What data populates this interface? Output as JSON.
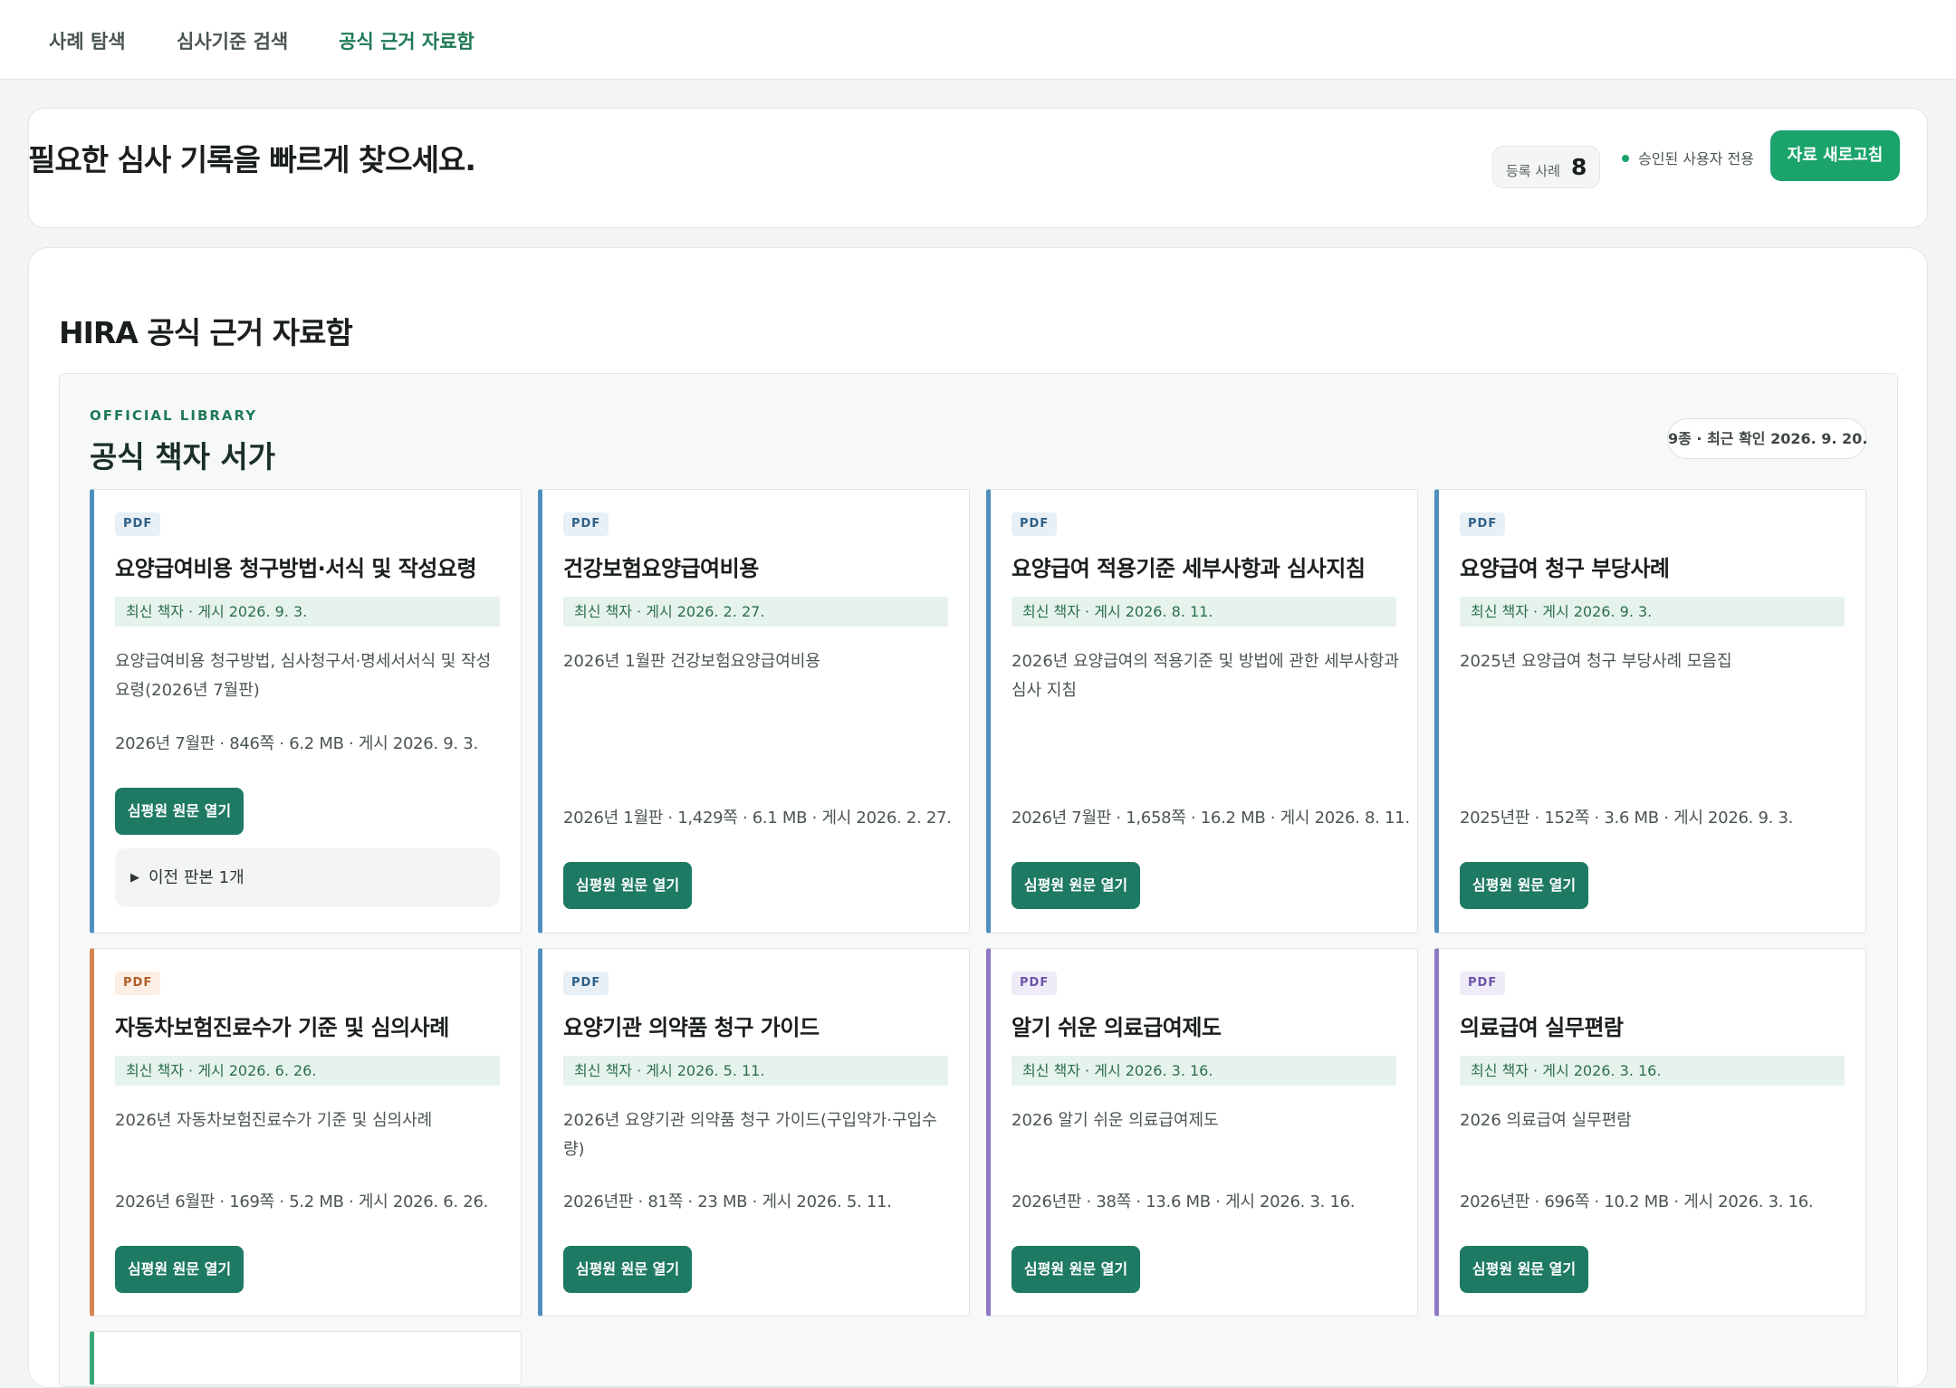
{
  "nav": {
    "tabs": [
      {
        "label": "사례 탐색"
      },
      {
        "label": "심사기준 검색"
      },
      {
        "label": "공식 근거 자료함"
      }
    ]
  },
  "hero": {
    "title": "필요한 심사 기록을 빠르게 찾으세요.",
    "count_label": "등록 사례",
    "count_value": "8",
    "auth_text": "승인된 사용자 전용",
    "refresh_label": "자료 새로고침"
  },
  "panel": {
    "title": "HIRA 공식 근거 자료함"
  },
  "shelf": {
    "eyebrow": "OFFICIAL LIBRARY",
    "title": "공식 책자 서가",
    "meta": "9종 · 최근 확인 2026. 9. 20."
  },
  "cards": [
    {
      "badge": "PDF",
      "title": "요양급여비용 청구방법·서식 및 작성요령",
      "latest": "최신 책자 · 게시 2026. 9. 3.",
      "desc": "요양급여비용 청구방법, 심사청구서·명세서서식 및 작성요령(2026년 7월판)",
      "info": "2026년 7월판 · 846쪽 · 6.2 MB · 게시 2026. 9. 3.",
      "button": "심평원 원문 열기",
      "previous": "이전 판본 1개"
    },
    {
      "badge": "PDF",
      "title": "건강보험요양급여비용",
      "latest": "최신 책자 · 게시 2026. 2. 27.",
      "desc": "2026년 1월판 건강보험요양급여비용",
      "info": "2026년 1월판 · 1,429쪽 · 6.1 MB · 게시 2026. 2. 27.",
      "button": "심평원 원문 열기"
    },
    {
      "badge": "PDF",
      "title": "요양급여 적용기준 세부사항과 심사지침",
      "latest": "최신 책자 · 게시 2026. 8. 11.",
      "desc": "2026년 요양급여의 적용기준 및 방법에 관한 세부사항과 심사 지침",
      "info": "2026년 7월판 · 1,658쪽 · 16.2 MB · 게시 2026. 8. 11.",
      "button": "심평원 원문 열기"
    },
    {
      "badge": "PDF",
      "title": "요양급여 청구 부당사례",
      "latest": "최신 책자 · 게시 2026. 9. 3.",
      "desc": "2025년 요양급여 청구 부당사례 모음집",
      "info": "2025년판 · 152쪽 · 3.6 MB · 게시 2026. 9. 3.",
      "button": "심평원 원문 열기"
    },
    {
      "badge": "PDF",
      "title": "자동차보험진료수가 기준 및 심의사례",
      "latest": "최신 책자 · 게시 2026. 6. 26.",
      "desc": "2026년 자동차보험진료수가 기준 및 심의사례",
      "info": "2026년 6월판 · 169쪽 · 5.2 MB · 게시 2026. 6. 26.",
      "button": "심평원 원문 열기"
    },
    {
      "badge": "PDF",
      "title": "요양기관 의약품 청구 가이드",
      "latest": "최신 책자 · 게시 2026. 5. 11.",
      "desc": "2026년 요양기관 의약품 청구 가이드(구입약가·구입수량)",
      "info": "2026년판 · 81쪽 · 23 MB · 게시 2026. 5. 11.",
      "button": "심평원 원문 열기"
    },
    {
      "badge": "PDF",
      "title": "알기 쉬운 의료급여제도",
      "latest": "최신 책자 · 게시 2026. 3. 16.",
      "desc": "2026 알기 쉬운 의료급여제도",
      "info": "2026년판 · 38쪽 · 13.6 MB · 게시 2026. 3. 16.",
      "button": "심평원 원문 열기"
    },
    {
      "badge": "PDF",
      "title": "의료급여 실무편람",
      "latest": "최신 책자 · 게시 2026. 3. 16.",
      "desc": "2026 의료급여 실무편람",
      "info": "2026년판 · 696쪽 · 10.2 MB · 게시 2026. 3. 16.",
      "button": "심평원 원문 열기"
    }
  ],
  "colors": {
    "brand_green": "#1aa36b",
    "button_teal": "#1f7a63",
    "accent_blue": "#4f8fbf",
    "accent_orange": "#d78452",
    "accent_purple": "#8e7ac2"
  }
}
